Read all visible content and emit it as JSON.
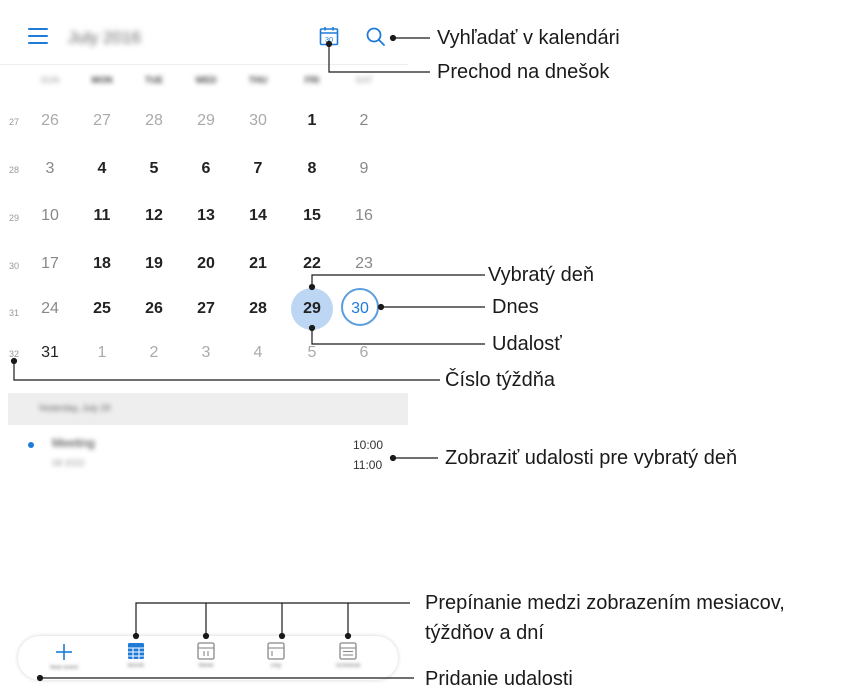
{
  "header": {
    "month": "July 2016",
    "today_day": "30"
  },
  "weekdays": [
    "SUN",
    "MON",
    "TUE",
    "WED",
    "THU",
    "FRI",
    "SAT"
  ],
  "weeks": [
    {
      "num": "27",
      "days": [
        "26",
        "27",
        "28",
        "29",
        "30",
        "1",
        "2"
      ]
    },
    {
      "num": "28",
      "days": [
        "3",
        "4",
        "5",
        "6",
        "7",
        "8",
        "9"
      ]
    },
    {
      "num": "29",
      "days": [
        "10",
        "11",
        "12",
        "13",
        "14",
        "15",
        "16"
      ]
    },
    {
      "num": "30",
      "days": [
        "17",
        "18",
        "19",
        "20",
        "21",
        "22",
        "23"
      ]
    },
    {
      "num": "31",
      "days": [
        "24",
        "25",
        "26",
        "27",
        "28",
        "29",
        "30"
      ]
    },
    {
      "num": "32",
      "days": [
        "31",
        "1",
        "2",
        "3",
        "4",
        "5",
        "6"
      ]
    }
  ],
  "selected_day": "29",
  "today": "30",
  "events": {
    "heading": "Yesterday, July 29",
    "items": [
      {
        "title": "Meeting",
        "subtitle": "08 2022",
        "start": "10:00",
        "end": "11:00"
      }
    ]
  },
  "bottom_nav": [
    {
      "label": "New event",
      "icon": "plus-icon"
    },
    {
      "label": "Month",
      "icon": "month-grid-icon"
    },
    {
      "label": "Week",
      "icon": "week-view-icon"
    },
    {
      "label": "Day",
      "icon": "day-view-icon"
    },
    {
      "label": "Schedule",
      "icon": "schedule-list-icon"
    }
  ],
  "annotations": {
    "search": "Vyhľadať v kalendári",
    "today": "Prechod na dnešok",
    "selected": "Vybratý deň",
    "today_day": "Dnes",
    "event": "Udalosť",
    "week_number": "Číslo týždňa",
    "show_events": "Zobraziť udalosti pre vybratý deň",
    "switch_views_line1": "Prepínanie medzi zobrazením mesiacov,",
    "switch_views_line2": "týždňov a dní",
    "add_event": "Pridanie udalosti"
  },
  "colors": {
    "accent": "#1e7bd8",
    "selected_fill": "#bcd6f3",
    "today_ring": "#5a9ee0"
  }
}
